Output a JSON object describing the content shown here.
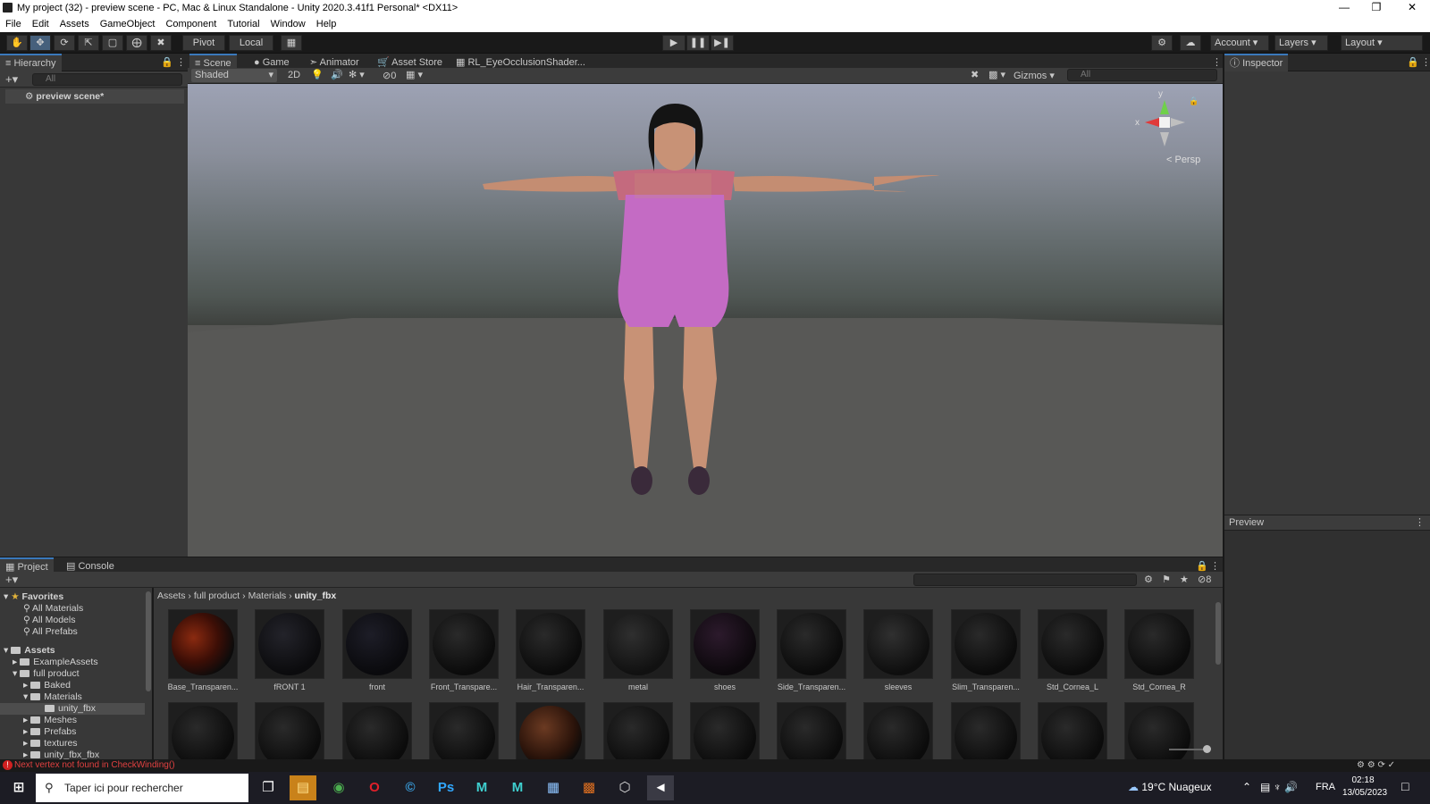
{
  "window": {
    "title": "My project (32) - preview scene - PC, Mac & Linux Standalone - Unity 2020.3.41f1 Personal* <DX11>"
  },
  "menu": [
    "File",
    "Edit",
    "Assets",
    "GameObject",
    "Component",
    "Tutorial",
    "Window",
    "Help"
  ],
  "toolbar": {
    "pivot": "Pivot",
    "local": "Local",
    "account": "Account",
    "layers": "Layers",
    "layout": "Layout"
  },
  "hierarchy": {
    "tab": "Hierarchy",
    "search_placeholder": "All",
    "scene": "preview scene*"
  },
  "scene_tabs": [
    "Scene",
    "Game",
    "Animator",
    "Asset Store",
    "RL_EyeOcclusionShader..."
  ],
  "scene_bar": {
    "shading": "Shaded",
    "mode_2d": "2D",
    "hidden_count": "0",
    "gizmos": "Gizmos",
    "search_placeholder": "All"
  },
  "gizmo": {
    "y": "y",
    "x": "x",
    "persp": "< Persp"
  },
  "inspector": {
    "tab": "Inspector",
    "preview": "Preview"
  },
  "project": {
    "tabs": [
      "Project",
      "Console"
    ],
    "hidden_count": "8",
    "favorites": {
      "label": "Favorites",
      "items": [
        "All Materials",
        "All Models",
        "All Prefabs"
      ]
    },
    "assets_root": "Assets",
    "tree": [
      "ExampleAssets",
      "full product",
      "Baked",
      "Materials",
      "unity_fbx",
      "Meshes",
      "Prefabs",
      "textures",
      "unity_fbx_fbx"
    ],
    "breadcrumb": [
      "Assets",
      "full product",
      "Materials",
      "unity_fbx"
    ],
    "assets": [
      "Base_Transparen...",
      "fRONT 1",
      "front",
      "Front_Transpare...",
      "Hair_Transparen...",
      "metal",
      "shoes",
      "Side_Transparen...",
      "sleeves",
      "Slim_Transparen...",
      "Std_Cornea_L",
      "Std_Cornea_R"
    ]
  },
  "status": {
    "message": "Next vertex not found in CheckWinding()"
  },
  "taskbar": {
    "search": "Taper ici pour rechercher",
    "weather": "19°C  Nuageux",
    "lang": "FRA",
    "time": "02:18",
    "date": "13/05/2023"
  }
}
